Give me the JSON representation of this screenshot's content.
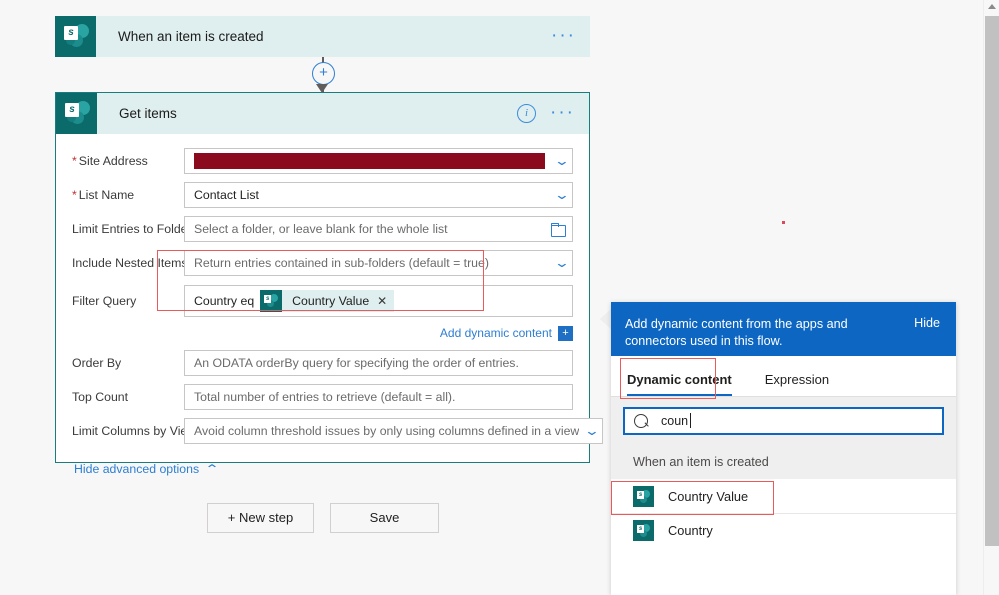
{
  "flow": {
    "trigger": {
      "title": "When an item is created",
      "icon": "sharepoint-icon",
      "menu_label": "···"
    },
    "connector": {
      "add_label": "+"
    },
    "action": {
      "title": "Get items",
      "icon": "sharepoint-icon",
      "info_label": "i",
      "menu_label": "···",
      "fields": [
        {
          "label": "Site Address",
          "required": true,
          "value": "",
          "redacted": true,
          "control": "dropdown"
        },
        {
          "label": "List Name",
          "required": true,
          "value": "Contact List",
          "control": "dropdown"
        },
        {
          "label": "Limit Entries to Folder",
          "required": false,
          "placeholder": "Select a folder, or leave blank for the whole list",
          "control": "folder-picker"
        },
        {
          "label": "Include Nested Items",
          "required": false,
          "placeholder": "Return entries contained in sub-folders (default = true)",
          "control": "dropdown"
        },
        {
          "label": "Filter Query",
          "required": false,
          "text_prefix": "Country eq",
          "token": {
            "label": "Country Value",
            "icon": "sharepoint-icon",
            "remove_label": "✕"
          },
          "control": "token-input"
        },
        {
          "label": "Order By",
          "required": false,
          "placeholder": "An ODATA orderBy query for specifying the order of entries.",
          "control": "text"
        },
        {
          "label": "Top Count",
          "required": false,
          "placeholder": "Total number of entries to retrieve (default = all).",
          "control": "text"
        },
        {
          "label": "Limit Columns by View",
          "required": false,
          "placeholder": "Avoid column threshold issues by only using columns defined in a view",
          "control": "dropdown"
        }
      ],
      "add_dynamic_content": {
        "link_label": "Add dynamic content",
        "plus_label": "+"
      },
      "advanced_toggle": {
        "label": "Hide advanced options",
        "caret": "⌃"
      }
    }
  },
  "bottom_buttons": {
    "new_step": "+ New step",
    "save": "Save"
  },
  "dynamic_panel": {
    "header_text": "Add dynamic content from the apps and connectors used in this flow.",
    "hide_label": "Hide",
    "tabs": [
      {
        "label": "Dynamic content",
        "active": true
      },
      {
        "label": "Expression",
        "active": false
      }
    ],
    "search": {
      "value": "coun",
      "placeholder": "",
      "icon": "search-icon"
    },
    "group_label": "When an item is created",
    "items": [
      {
        "label": "Country Value",
        "icon": "sharepoint-icon",
        "highlighted": true
      },
      {
        "label": "Country",
        "icon": "sharepoint-icon",
        "highlighted": false
      }
    ]
  },
  "annotations": {
    "accent_red": "#ea5a5a",
    "boxes": [
      "filter-query-region",
      "dynamic-content-tab",
      "country-value-item"
    ]
  },
  "colors": {
    "sharepoint_teal": "#0b6a6a",
    "card_header": "#dfeeee",
    "panel_blue": "#0c66c2",
    "link_blue": "#2d7fd3",
    "redaction": "#8b0a1e"
  }
}
